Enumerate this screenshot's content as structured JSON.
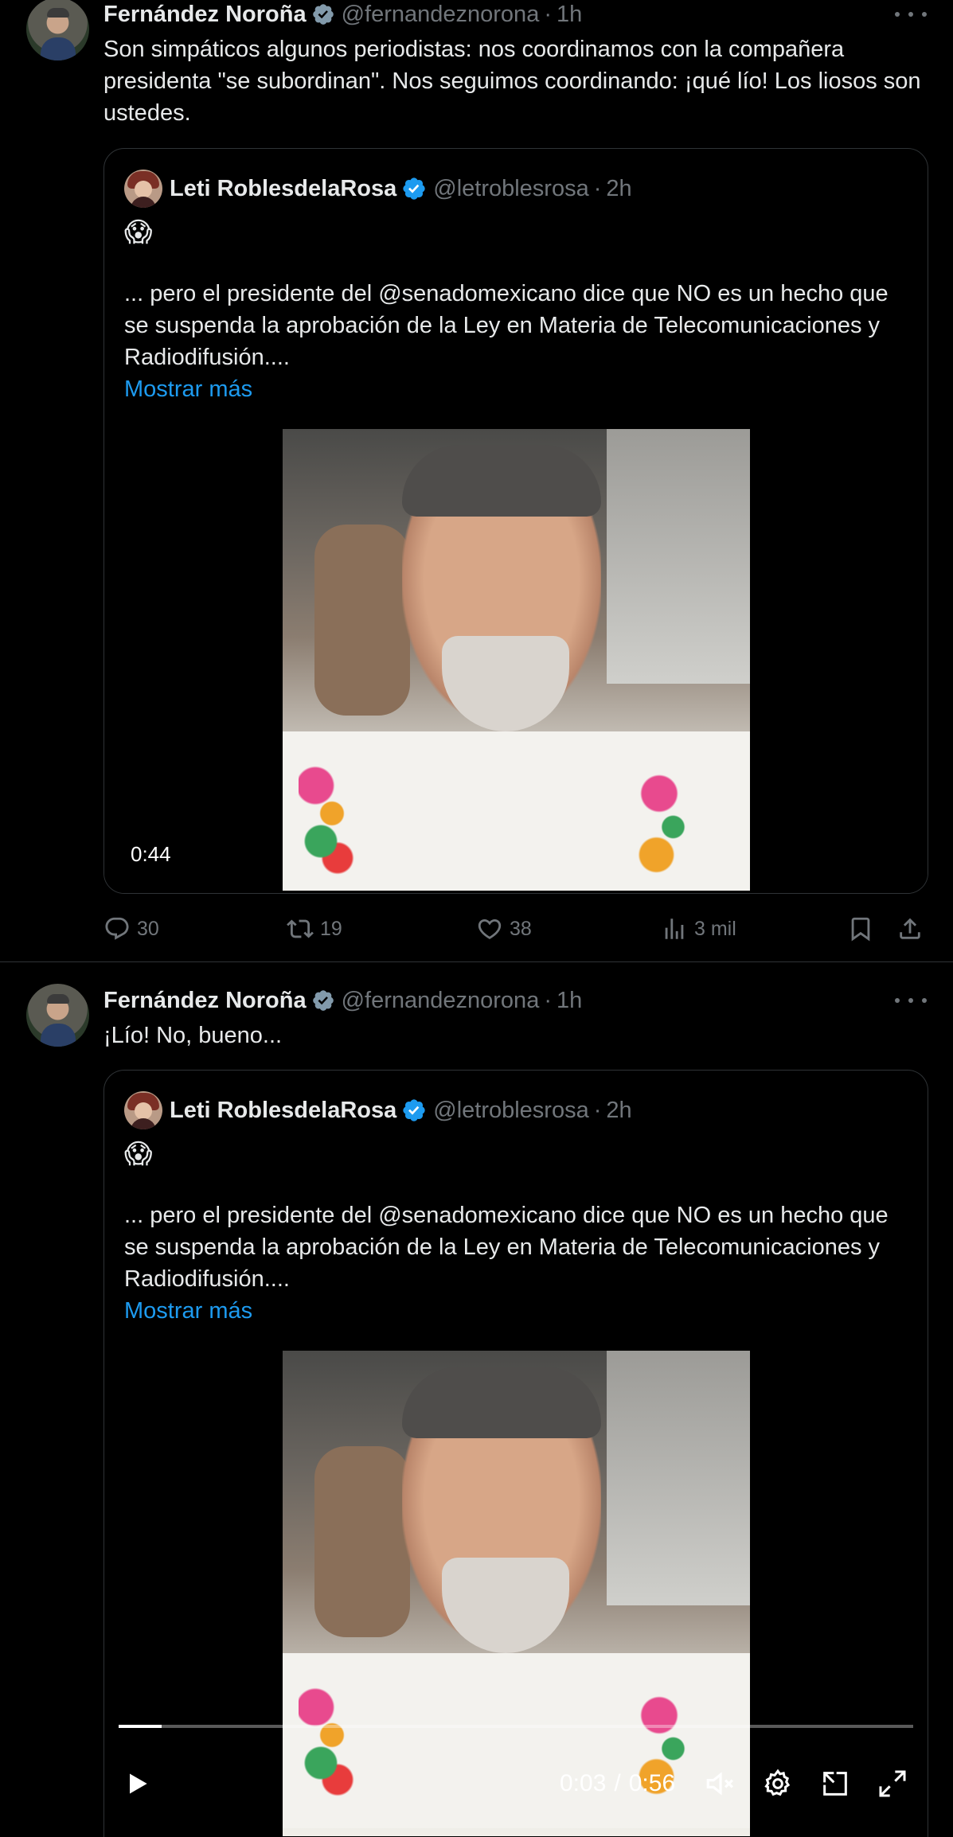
{
  "tweets": [
    {
      "author": {
        "display_name": "Fernández Noroña",
        "handle": "@fernandeznorona",
        "time": "1h"
      },
      "text": "Son simpáticos algunos periodistas: nos coordinamos con la compañera presidenta \"se subordinan\". Nos seguimos coordinando: ¡qué lío! Los liosos son ustedes.",
      "quote": {
        "author": {
          "display_name": "Leti RoblesdelaRosa",
          "handle": "@letroblesrosa",
          "time": "2h"
        },
        "emoji": "😱",
        "text": "... pero el presidente del @senadomexicano dice que NO es un hecho que se suspenda la aprobación de la Ley en Materia de Telecomunicaciones y Radiodifusión....",
        "show_more": "Mostrar más",
        "video": {
          "duration": "0:44"
        }
      },
      "actions": {
        "replies": "30",
        "reposts": "19",
        "likes": "38",
        "views": "3 mil"
      }
    },
    {
      "author": {
        "display_name": "Fernández Noroña",
        "handle": "@fernandeznorona",
        "time": "1h"
      },
      "text": "¡Lío! No, bueno...",
      "quote": {
        "author": {
          "display_name": "Leti RoblesdelaRosa",
          "handle": "@letroblesrosa",
          "time": "2h"
        },
        "emoji": "😱",
        "text": "... pero el presidente del @senadomexicano dice que NO es un hecho que se suspenda la aprobación de la Ley en Materia de Telecomunicaciones y Radiodifusión....",
        "show_more": "Mostrar más",
        "video": {
          "current_time": "0:03",
          "separator": "/",
          "duration": "0:56",
          "progress": 0.054
        }
      }
    }
  ],
  "colors": {
    "background": "#000000",
    "text": "#e7e9ea",
    "muted": "#71767b",
    "link": "#1d9bf0",
    "verified": "#1d9bf0",
    "verified_gray": "#829aab",
    "divider": "#2f3336"
  },
  "icons": {
    "verified_author": "verified-gray-badge-icon",
    "verified_quote": "verified-blue-badge-icon",
    "more": "more-dots-icon",
    "reply": "reply-icon",
    "repost": "repost-icon",
    "like": "heart-icon",
    "views": "views-icon",
    "bookmark": "bookmark-icon",
    "share": "share-icon",
    "play": "play-icon",
    "mute": "mute-icon",
    "settings": "gear-icon",
    "pip": "pip-icon",
    "fullscreen": "fullscreen-icon"
  }
}
